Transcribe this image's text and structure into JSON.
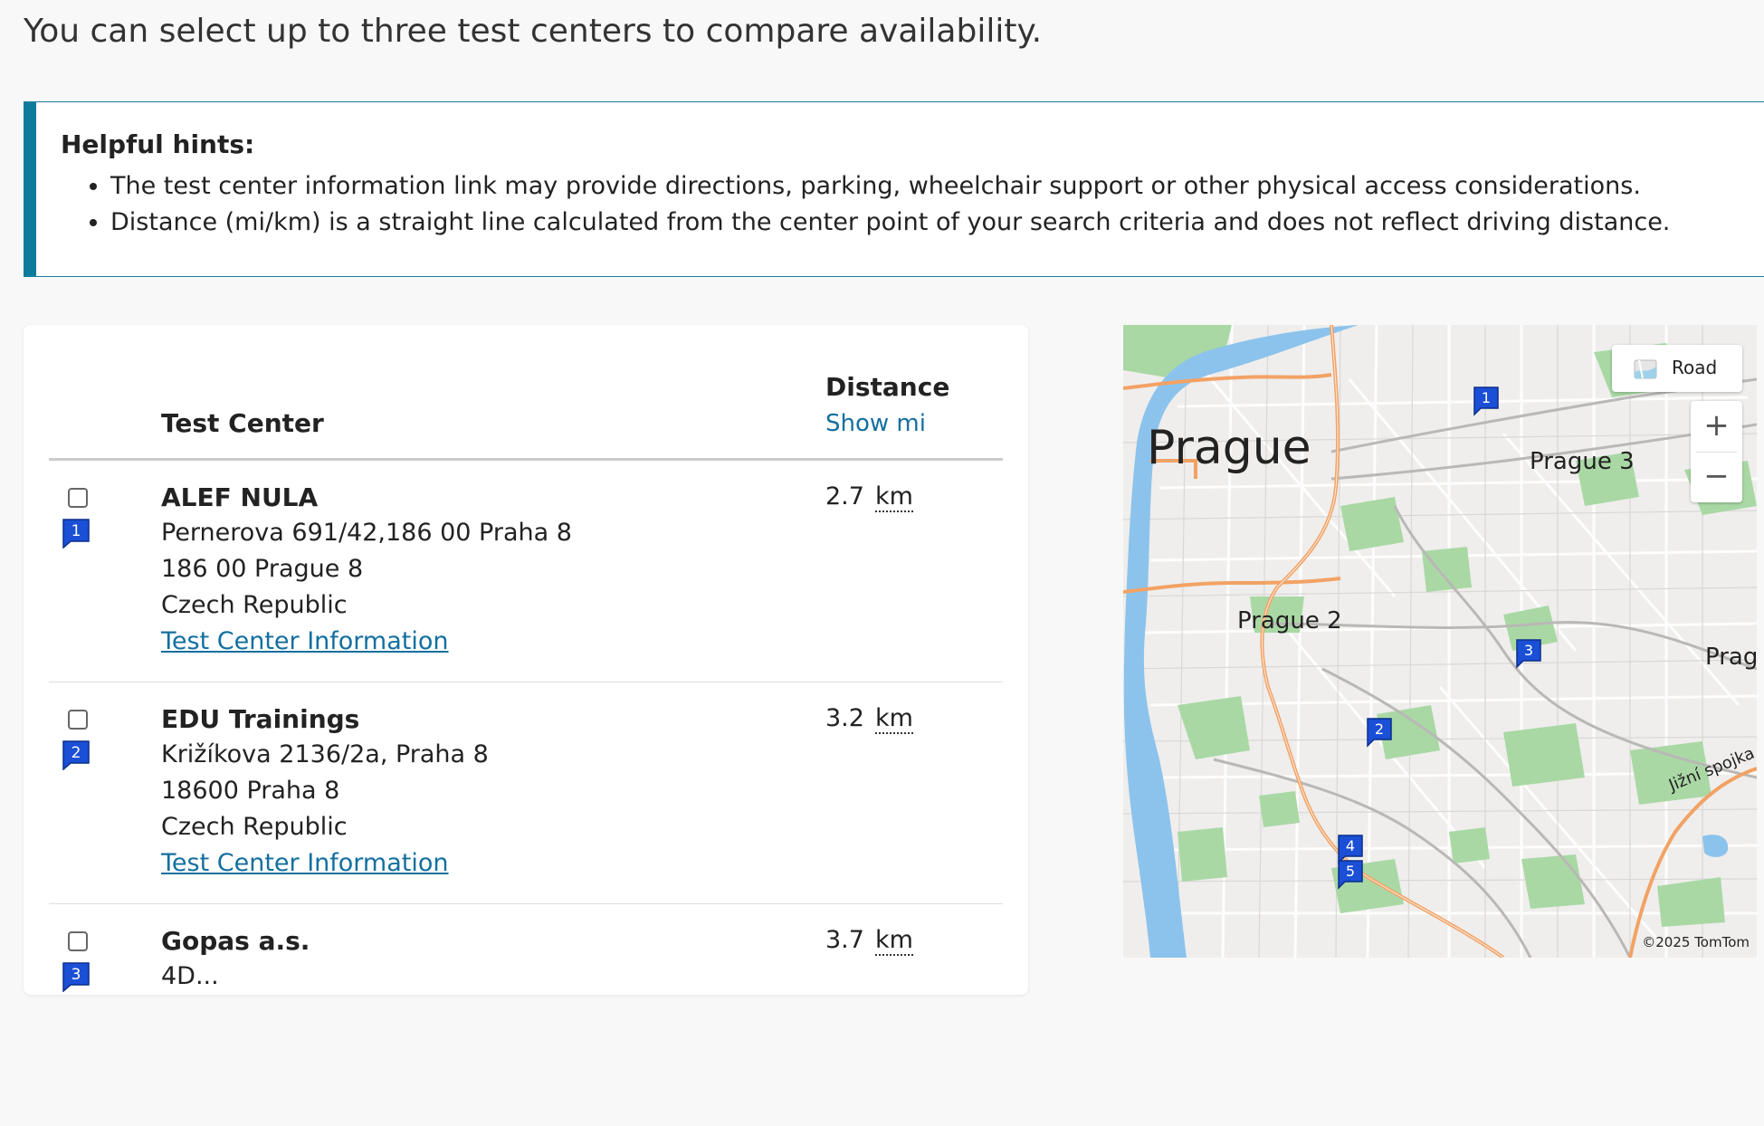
{
  "intro": "You can select up to three test centers to compare availability.",
  "hints": {
    "title": "Helpful hints:",
    "items": [
      "The test center information link may provide directions, parking, wheelchair support or other physical access considerations.",
      "Distance (mi/km) is a straight line calculated from the center point of your search criteria and does not reflect driving distance."
    ]
  },
  "table": {
    "col_center": "Test Center",
    "col_distance": "Distance",
    "show_unit_link": "Show mi",
    "rows": [
      {
        "number": "1",
        "name": "ALEF NULA",
        "address": [
          "Pernerova 691/42,186 00 Praha 8",
          "186 00 Prague 8",
          "Czech Republic"
        ],
        "link": "Test Center Information",
        "distance": "2.7",
        "unit": "km"
      },
      {
        "number": "2",
        "name": "EDU Trainings",
        "address": [
          "Križíkova 2136/2a, Praha 8",
          "18600 Praha 8",
          "Czech Republic"
        ],
        "link": "Test Center Information",
        "distance": "3.2",
        "unit": "km"
      },
      {
        "number": "3",
        "name": "Gopas a.s.",
        "address": [
          "4D..."
        ],
        "link": "",
        "distance": "3.7",
        "unit": "km"
      }
    ]
  },
  "map": {
    "labels": {
      "city": "Prague",
      "prague3": "Prague 3",
      "prague2": "Prague 2",
      "pragu": "Pragu",
      "jizni": "Jižní spojka"
    },
    "road_button": "Road",
    "zoom_in": "+",
    "zoom_out": "−",
    "pins": [
      "1",
      "2",
      "3",
      "4",
      "5"
    ],
    "copyright": "©2025 TomTom"
  },
  "colors": {
    "accent": "#0d7c9c",
    "link": "#136fa0",
    "pin": "#1a4fd6",
    "water": "#8cc3ec",
    "park": "#a9d8a5",
    "highway": "#f2a265"
  }
}
